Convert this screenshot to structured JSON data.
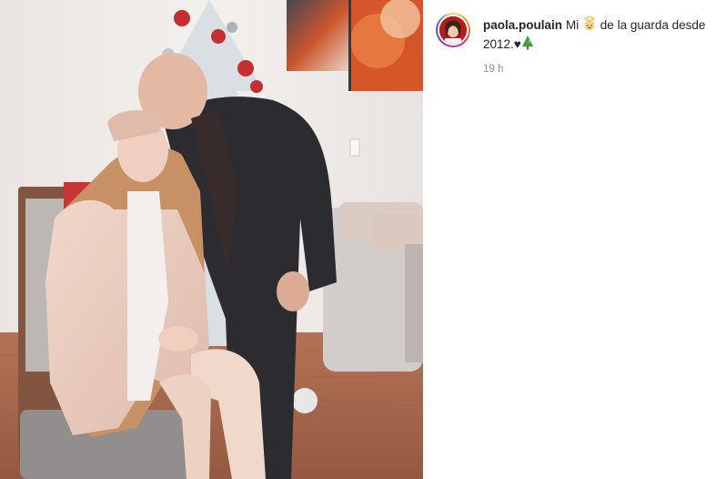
{
  "post": {
    "username": "paola.poulain",
    "caption_before_emoji": "Mi",
    "caption_after_emoji": "de la guarda desde 2012.",
    "caption_heart": "♥",
    "timestamp": "19 h",
    "emojis": [
      "angel-emoji",
      "christmas-tree-emoji"
    ]
  }
}
